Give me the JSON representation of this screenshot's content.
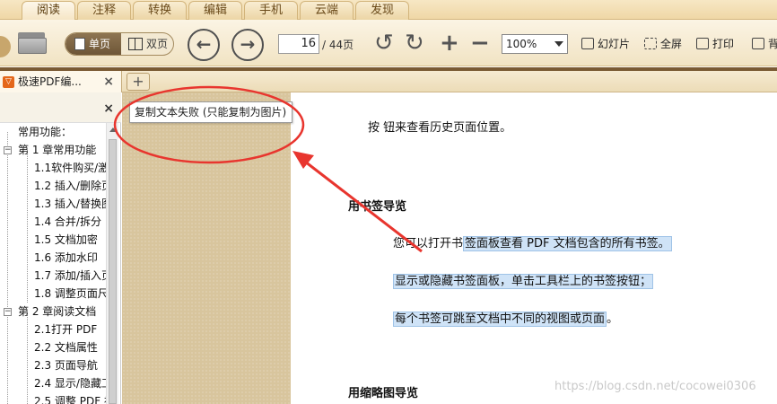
{
  "menu": {
    "tabs": [
      "阅读",
      "注释",
      "转换",
      "编辑",
      "手机",
      "云端",
      "发现"
    ]
  },
  "toolbar": {
    "view_single": "单页",
    "view_double": "双页",
    "page_current": "16",
    "page_total": "/ 44页",
    "zoom": "100%",
    "slideshow": "幻灯片",
    "fullscreen": "全屏",
    "print": "打印",
    "background": "背"
  },
  "doc_tab": {
    "title": "极速PDF编...",
    "close": "×",
    "add": "+"
  },
  "sidebar": {
    "close": "×",
    "items": [
      "常用功能：",
      "第 1 章常用功能",
      "1.1软件购买/激",
      "1.2 插入/删除页",
      "1.3 插入/替换图",
      "1.4 合并/拆分",
      "1.5 文档加密",
      "1.6 添加水印",
      "1.7 添加/插入页",
      "1.8 调整页面尺",
      "第 2 章阅读文档",
      "2.1打开 PDF",
      "2.2 文档属性",
      "2.3 页面导航",
      "2.4 显示/隐藏工",
      "2.5 调整 PDF 视"
    ]
  },
  "tooltip": "复制文本失败 (只能复制为图片)",
  "document": {
    "line1": "按 钮来查看历史页面位置。",
    "heading1": "用书签导览",
    "para1_plain": "您可以打开书",
    "para1_sel": "签面板查看 PDF 文档包含的所有书签。",
    "para2": "显示或隐藏书签面板，单击工具栏上的书签按钮；",
    "para3_sel": "每个书签可跳至文档中不同的视图或页面",
    "para3_tail": "。",
    "heading2": "用缩略图导览"
  },
  "watermark": "https://blog.csdn.net/cocowei0306",
  "colors": {
    "annotation": "#e8352e",
    "selection": "#cfe3f7",
    "gutter": "#d8c59d"
  }
}
